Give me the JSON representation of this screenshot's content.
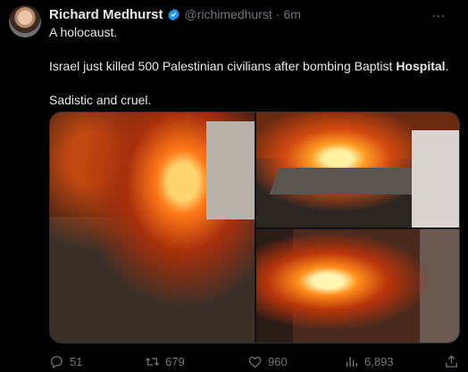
{
  "tweet": {
    "author_name": "Richard Medhurst",
    "handle": "@richimedhurst",
    "separator": "·",
    "time": "6m",
    "more_icon": "…",
    "lines": [
      "A holocaust.",
      "Israel just killed 500 Palestinian civilians after bombing Baptist ",
      "Hospital",
      ".",
      "Sadistic and cruel."
    ]
  },
  "actions": {
    "replies": "51",
    "retweets": "679",
    "likes": "960",
    "views": "6,893"
  },
  "colors": {
    "background": "#000000",
    "text": "#e7e9ea",
    "muted": "#71767b",
    "verified": "#1d9bf0"
  }
}
